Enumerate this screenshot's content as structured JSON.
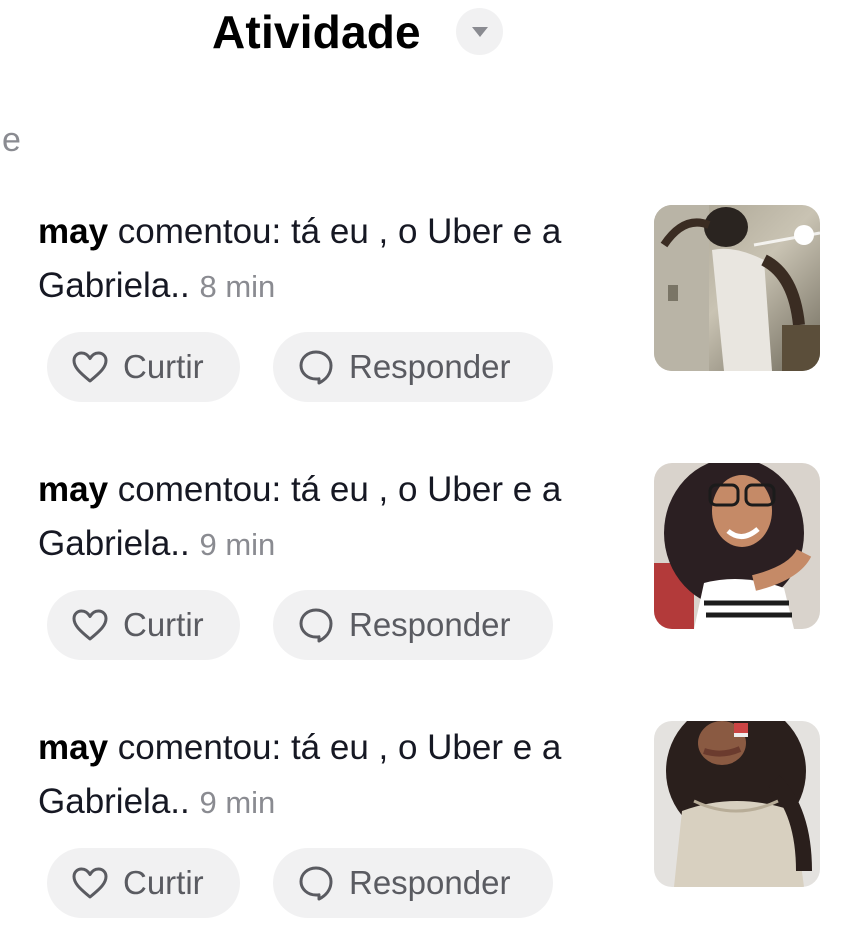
{
  "header": {
    "title": "Atividade",
    "dropdown_icon": "caret-down-icon"
  },
  "section_fragment": "e",
  "colors": {
    "text_primary": "#161823",
    "text_secondary": "#8a8b91",
    "button_bg": "#f1f1f2",
    "button_text": "#5a5b61"
  },
  "activity": [
    {
      "username": "may",
      "action": "comentou: tá eu , o Uber e a Gabriela..",
      "time": "8 min",
      "like_label": "Curtir",
      "reply_label": "Responder",
      "like_icon": "heart-outline-icon",
      "reply_icon": "speech-bubble-icon",
      "thumbnail": "video-thumbnail"
    },
    {
      "username": "may",
      "action": "comentou: tá eu , o Uber e a Gabriela..",
      "time": "9 min",
      "like_label": "Curtir",
      "reply_label": "Responder",
      "like_icon": "heart-outline-icon",
      "reply_icon": "speech-bubble-icon",
      "thumbnail": "video-thumbnail"
    },
    {
      "username": "may",
      "action": "comentou: tá eu , o Uber e a Gabriela..",
      "time": "9 min",
      "like_label": "Curtir",
      "reply_label": "Responder",
      "like_icon": "heart-outline-icon",
      "reply_icon": "speech-bubble-icon",
      "thumbnail": "video-thumbnail"
    }
  ]
}
